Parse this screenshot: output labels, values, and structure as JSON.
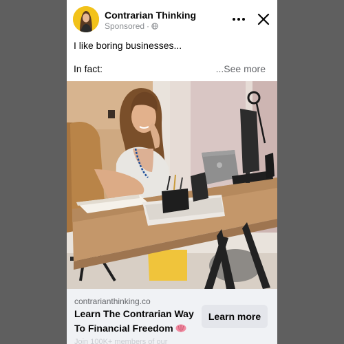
{
  "ad": {
    "advertiser": "Contrarian Thinking",
    "sponsored": "Sponsored",
    "sponsored_sep": "·",
    "text_line1": "I like boring businesses...",
    "text_line2": "In fact:",
    "see_more": "...See more"
  },
  "icons": {
    "more": "more-horizontal-icon",
    "close": "close-x-icon",
    "privacy": "globe-icon",
    "emoji": "brain-emoji-icon"
  },
  "footer": {
    "domain": "contrarianthinking.co",
    "headline": "Learn The Contrarian Way To Financial Freedom",
    "cta": "Learn more",
    "truncated_text": "Join 100K+ members of our"
  },
  "colors": {
    "page_bg": "#5f5f5f",
    "card_bg": "#ffffff",
    "footer_bg": "#f0f2f5",
    "button_bg": "#e4e6eb",
    "avatar_bg": "#f2c21a",
    "secondary_text": "#65676b"
  }
}
